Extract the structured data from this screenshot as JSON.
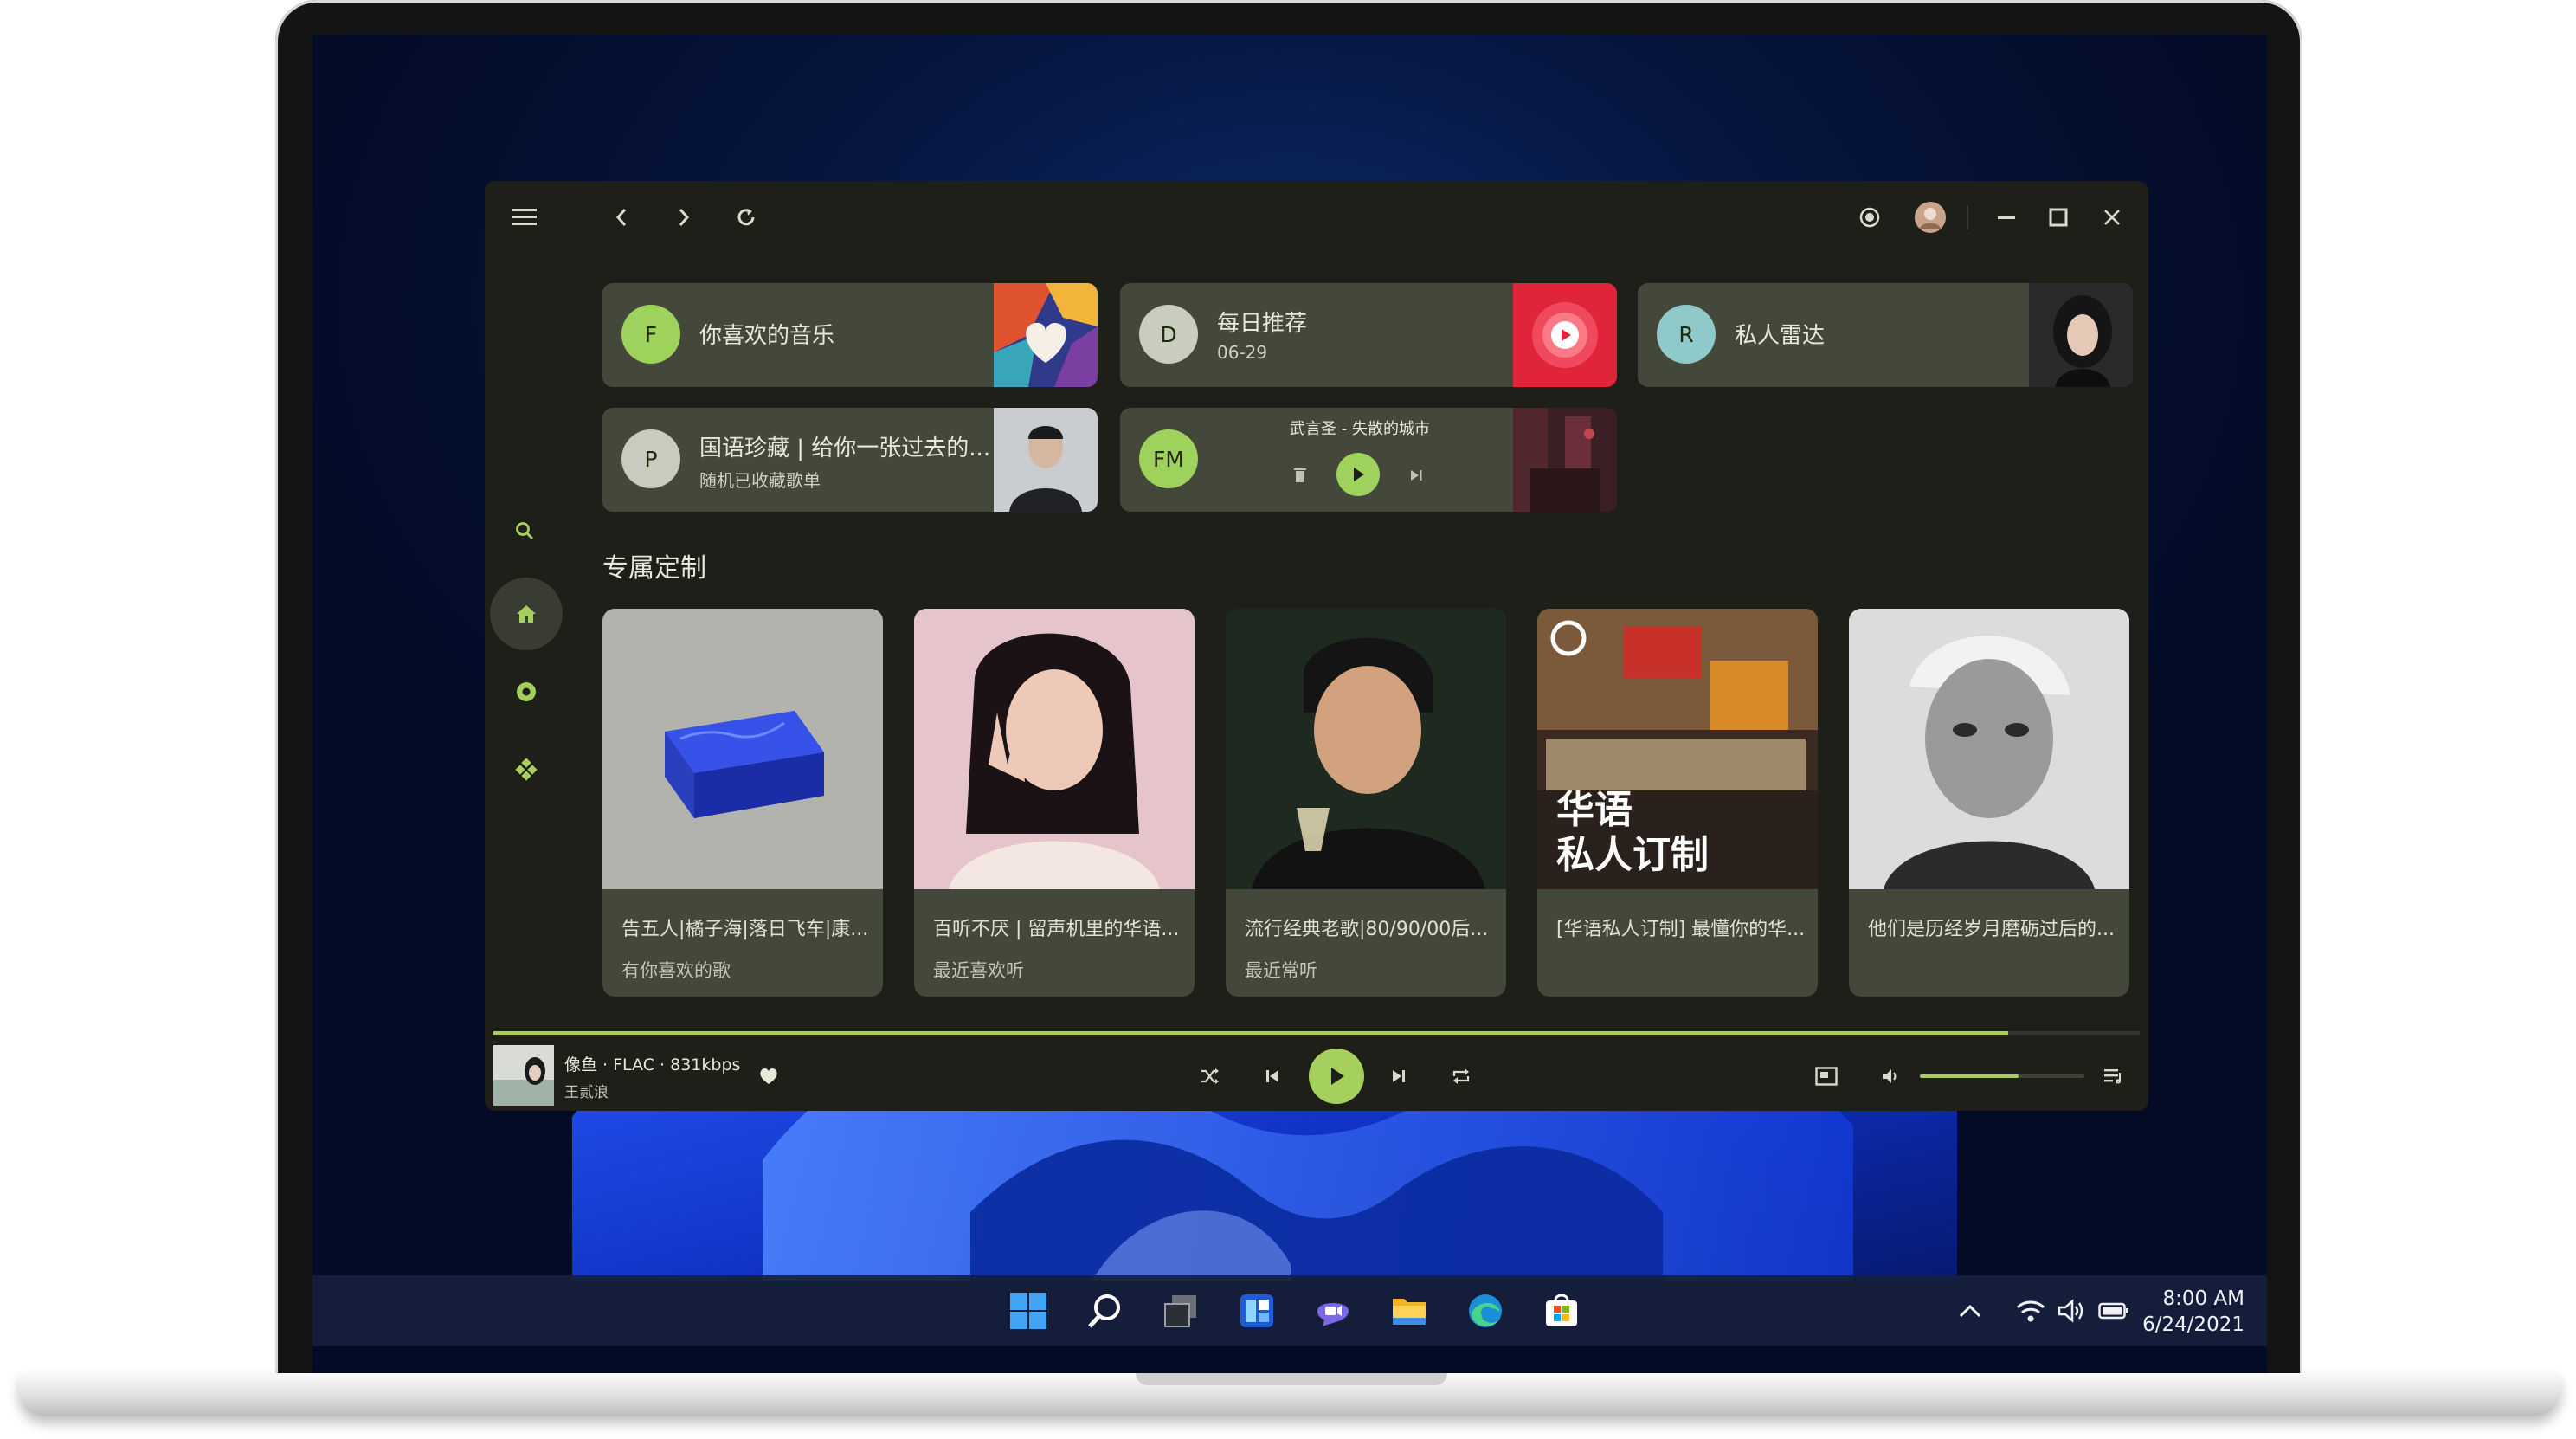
{
  "app": {
    "quick_cards": [
      {
        "avatar": "F",
        "title": "你喜欢的音乐",
        "subtitle": ""
      },
      {
        "avatar": "D",
        "title": "每日推荐",
        "subtitle": "06-29"
      },
      {
        "avatar": "R",
        "title": "私人雷达",
        "subtitle": ""
      },
      {
        "avatar": "P",
        "title": "国语珍藏 | 给你一张过去的...",
        "subtitle": "随机已收藏歌单"
      },
      {
        "avatar": "FM",
        "title": "武言圣 - 失散的城市",
        "subtitle": ""
      }
    ],
    "section_title": "专属定制",
    "playlists": [
      {
        "title": "告五人|橘子海|落日飞车|康...",
        "subtitle": "有你喜欢的歌"
      },
      {
        "title": "百听不厌 | 留声机里的华语...",
        "subtitle": "最近喜欢听"
      },
      {
        "title": "流行经典老歌|80/90/00后...",
        "subtitle": "最近常听"
      },
      {
        "title": "[华语私人订制] 最懂你的华...",
        "subtitle": "",
        "overlay_line1": "华语",
        "overlay_line2": "私人订制"
      },
      {
        "title": "他们是历经岁月磨砺过后的...",
        "subtitle": ""
      }
    ],
    "now_playing": {
      "title": "像鱼 · FLAC · 831kbps",
      "artist": "王贰浪",
      "progress": 0.92,
      "volume": 0.6
    },
    "accent_color": "#a6d05d",
    "icons": {
      "menu": "menu-icon",
      "back": "chevron-left-icon",
      "forward": "chevron-right-icon",
      "refresh": "refresh-icon",
      "record": "record-icon",
      "minimize": "minimize-icon",
      "maximize": "maximize-icon",
      "close": "close-icon"
    }
  },
  "taskbar": {
    "time": "8:00 AM",
    "date": "6/24/2021"
  }
}
